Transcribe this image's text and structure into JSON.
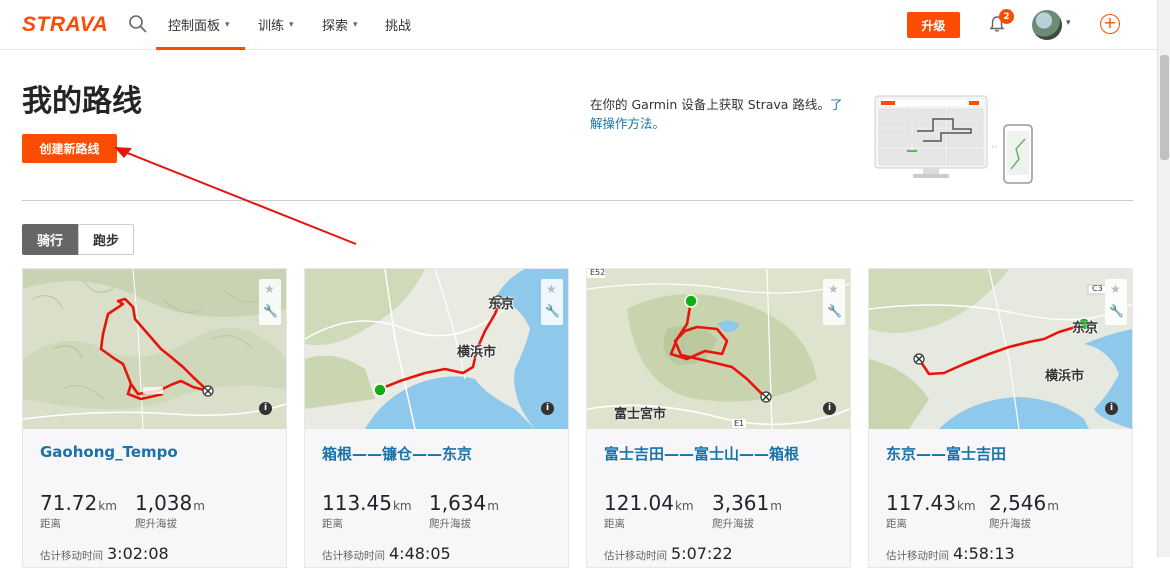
{
  "nav": {
    "logo": "STRAVA",
    "items": [
      "控制面板",
      "训练",
      "探索",
      "挑战"
    ],
    "upgrade": "升级",
    "notifications": "2"
  },
  "page": {
    "title": "我的路线",
    "create_button": "创建新路线",
    "garmin_text": "在你的 Garmin 设备上获取 Strava 路线。",
    "garmin_link": "了解操作方法。",
    "tabs": [
      "骑行",
      "跑步"
    ]
  },
  "routes": [
    {
      "title": "Gaohong_Tempo",
      "distance": "71.72",
      "distance_unit": "km",
      "elevation": "1,038",
      "elevation_unit": "m",
      "distance_label": "距离",
      "elevation_label": "爬升海拔",
      "time_label": "估计移动时间",
      "time": "3:02:08",
      "map_labels": []
    },
    {
      "title": "箱根——镰仓——东京",
      "distance": "113.45",
      "distance_unit": "km",
      "elevation": "1,634",
      "elevation_unit": "m",
      "distance_label": "距离",
      "elevation_label": "爬升海拔",
      "time_label": "估计移动时间",
      "time": "4:48:05",
      "map_labels": [
        "东京",
        "横浜市"
      ]
    },
    {
      "title": "富士吉田——富士山——箱根",
      "distance": "121.04",
      "distance_unit": "km",
      "elevation": "3,361",
      "elevation_unit": "m",
      "distance_label": "距离",
      "elevation_label": "爬升海拔",
      "time_label": "估计移动时间",
      "time": "5:07:22",
      "map_labels": [
        "富士宮市",
        "E52",
        "E1"
      ]
    },
    {
      "title": "东京——富士吉田",
      "distance": "117.43",
      "distance_unit": "km",
      "elevation": "2,546",
      "elevation_unit": "m",
      "distance_label": "距离",
      "elevation_label": "爬升海拔",
      "time_label": "估计移动时间",
      "time": "4:58:13",
      "map_labels": [
        "东京",
        "横浜市",
        "C3"
      ]
    }
  ],
  "colors": {
    "brand": "#fc4c02",
    "link": "#1a73a8",
    "route": "#e8140c"
  }
}
